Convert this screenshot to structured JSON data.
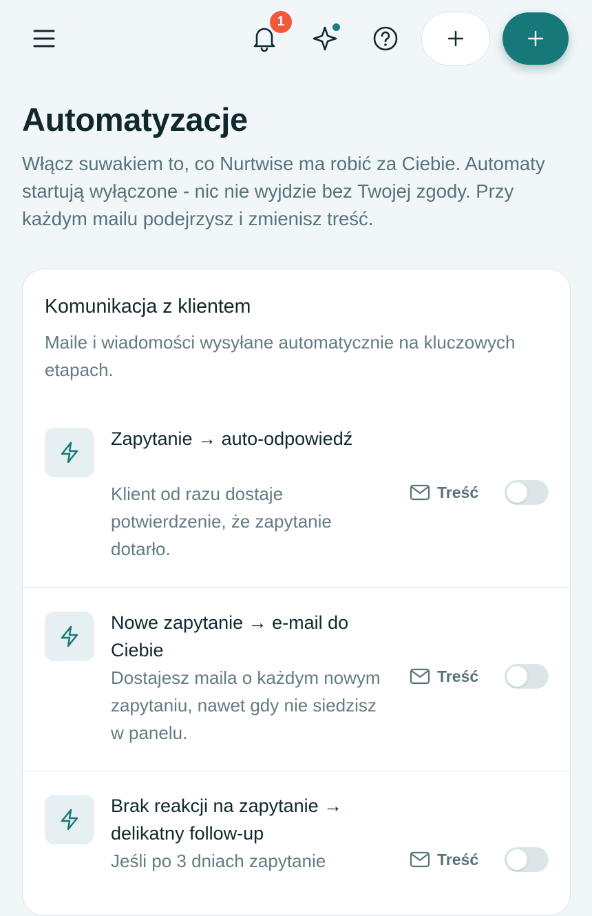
{
  "header": {
    "menu_icon": "hamburger-menu-icon",
    "notifications_icon": "bell-icon",
    "notifications_count": "1",
    "ai_icon": "sparkle-icon",
    "help_icon": "help-circle-icon",
    "add_icon": "plus-icon",
    "accent_color": "#17787a",
    "badge_color": "#f0593a"
  },
  "page": {
    "title": "Automatyzacje",
    "description": "Włącz suwakiem to, co Nurtwise ma robić za Ciebie. Automaty startują wyłączone - nic nie wyjdzie bez Twojej zgody. Przy każdym mailu podejrzysz i zmienisz treść."
  },
  "section": {
    "title": "Komunikacja z klientem",
    "description": "Maile i wiadomości wysyłane automatycznie na kluczowych etapach.",
    "items": [
      {
        "icon": "lightning-bolt-icon",
        "title": "Zapytanie → auto-odpowiedź",
        "description": "Klient od razu dostaje potwierdzenie, że zapytanie dotarło.",
        "content_label": "Treść",
        "content_icon": "mail-icon",
        "enabled": false
      },
      {
        "icon": "lightning-bolt-icon",
        "title": "Nowe zapytanie → e-mail do Ciebie",
        "description": "Dostajesz maila o każdym nowym zapytaniu, nawet gdy nie siedzisz w panelu.",
        "content_label": "Treść",
        "content_icon": "mail-icon",
        "enabled": false
      },
      {
        "icon": "lightning-bolt-icon",
        "title": "Brak reakcji na zapytanie → delikatny follow-up",
        "description": "Jeśli po 3 dniach zapytanie",
        "content_label": "Treść",
        "content_icon": "mail-icon",
        "enabled": false
      }
    ]
  }
}
